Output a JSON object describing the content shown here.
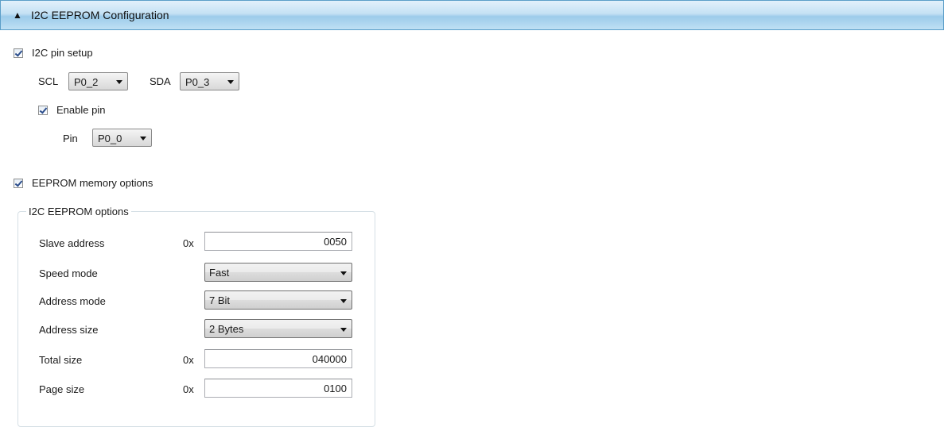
{
  "header": {
    "collapse_icon": "triangle-up-icon",
    "title": "I2C EEPROM Configuration"
  },
  "pin_setup": {
    "checkbox_label": "I2C pin setup",
    "checked": true,
    "scl": {
      "label": "SCL",
      "value": "P0_2"
    },
    "sda": {
      "label": "SDA",
      "value": "P0_3"
    },
    "enable_pin": {
      "checkbox_label": "Enable pin",
      "checked": true,
      "pin_label": "Pin",
      "pin_value": "P0_0"
    }
  },
  "memory": {
    "checkbox_label": "EEPROM memory options",
    "checked": true,
    "group_title": "I2C EEPROM options",
    "hex_prefix": "0x",
    "slave_address": {
      "label": "Slave address",
      "value": "0050"
    },
    "speed_mode": {
      "label": "Speed mode",
      "value": "Fast"
    },
    "address_mode": {
      "label": "Address mode",
      "value": "7 Bit"
    },
    "address_size": {
      "label": "Address size",
      "value": "2 Bytes"
    },
    "total_size": {
      "label": "Total size",
      "value": "040000"
    },
    "page_size": {
      "label": "Page size",
      "value": "0100"
    }
  }
}
